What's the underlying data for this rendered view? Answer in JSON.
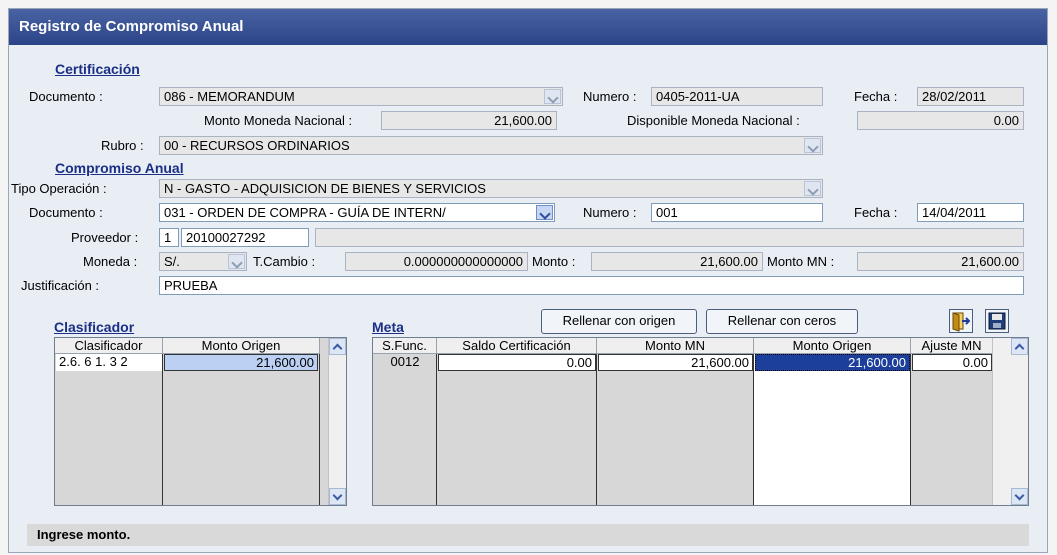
{
  "window": {
    "title": "Registro de Compromiso Anual"
  },
  "certificacion": {
    "section_title": "Certificación",
    "documento_label": "Documento :",
    "documento_value": "086 - MEMORANDUM",
    "numero_label": "Numero :",
    "numero_value": "0405-2011-UA",
    "fecha_label": "Fecha :",
    "fecha_value": "28/02/2011",
    "monto_label": "Monto Moneda Nacional :",
    "monto_value": "21,600.00",
    "disponible_label": "Disponible Moneda Nacional :",
    "disponible_value": "0.00",
    "rubro_label": "Rubro :",
    "rubro_value": "00 - RECURSOS ORDINARIOS"
  },
  "compromiso": {
    "section_title": "Compromiso Anual",
    "tipo_label": "Tipo Operación :",
    "tipo_value": "N  - GASTO - ADQUISICION DE BIENES Y SERVICIOS",
    "documento_label": "Documento :",
    "documento_value": "031 - ORDEN DE COMPRA - GUÍA DE INTERN/",
    "numero_label": "Numero :",
    "numero_value": "001",
    "fecha_label": "Fecha :",
    "fecha_value": "14/04/2011",
    "proveedor_label": "Proveedor :",
    "proveedor_tipo": "1",
    "proveedor_ruc": "20100027292",
    "proveedor_nombre": "",
    "moneda_label": "Moneda :",
    "moneda_value": "S/.",
    "tcambio_label": "T.Cambio :",
    "tcambio_value": "0.000000000000000",
    "monto_label": "Monto :",
    "monto_value": "21,600.00",
    "montomn_label": "Monto MN :",
    "montomn_value": "21,600.00",
    "justificacion_label": "Justificación :",
    "justificacion_value": "PRUEBA"
  },
  "clasificador": {
    "section_title": "Clasificador",
    "headers": [
      "Clasificador",
      "Monto Origen"
    ],
    "rows": [
      [
        "2.6. 6 1. 3 2",
        "21,600.00"
      ]
    ]
  },
  "meta": {
    "section_title": "Meta",
    "rellenar_origen_label": "Rellenar con origen",
    "rellenar_ceros_label": "Rellenar con ceros",
    "headers": [
      "S.Func.",
      "Saldo Certificación",
      "Monto MN",
      "Monto Origen",
      "Ajuste MN"
    ],
    "rows": [
      [
        "0012",
        "0.00",
        "21,600.00",
        "21,600.00",
        "0.00"
      ]
    ]
  },
  "status": {
    "message": "Ingrese monto."
  },
  "icons": {
    "exit": "exit-door-icon",
    "save": "floppy-disk-save-icon"
  },
  "colors": {
    "title_bar": "#2b4488",
    "section_title": "#1b2f86",
    "selection": "#1c3f9b"
  }
}
